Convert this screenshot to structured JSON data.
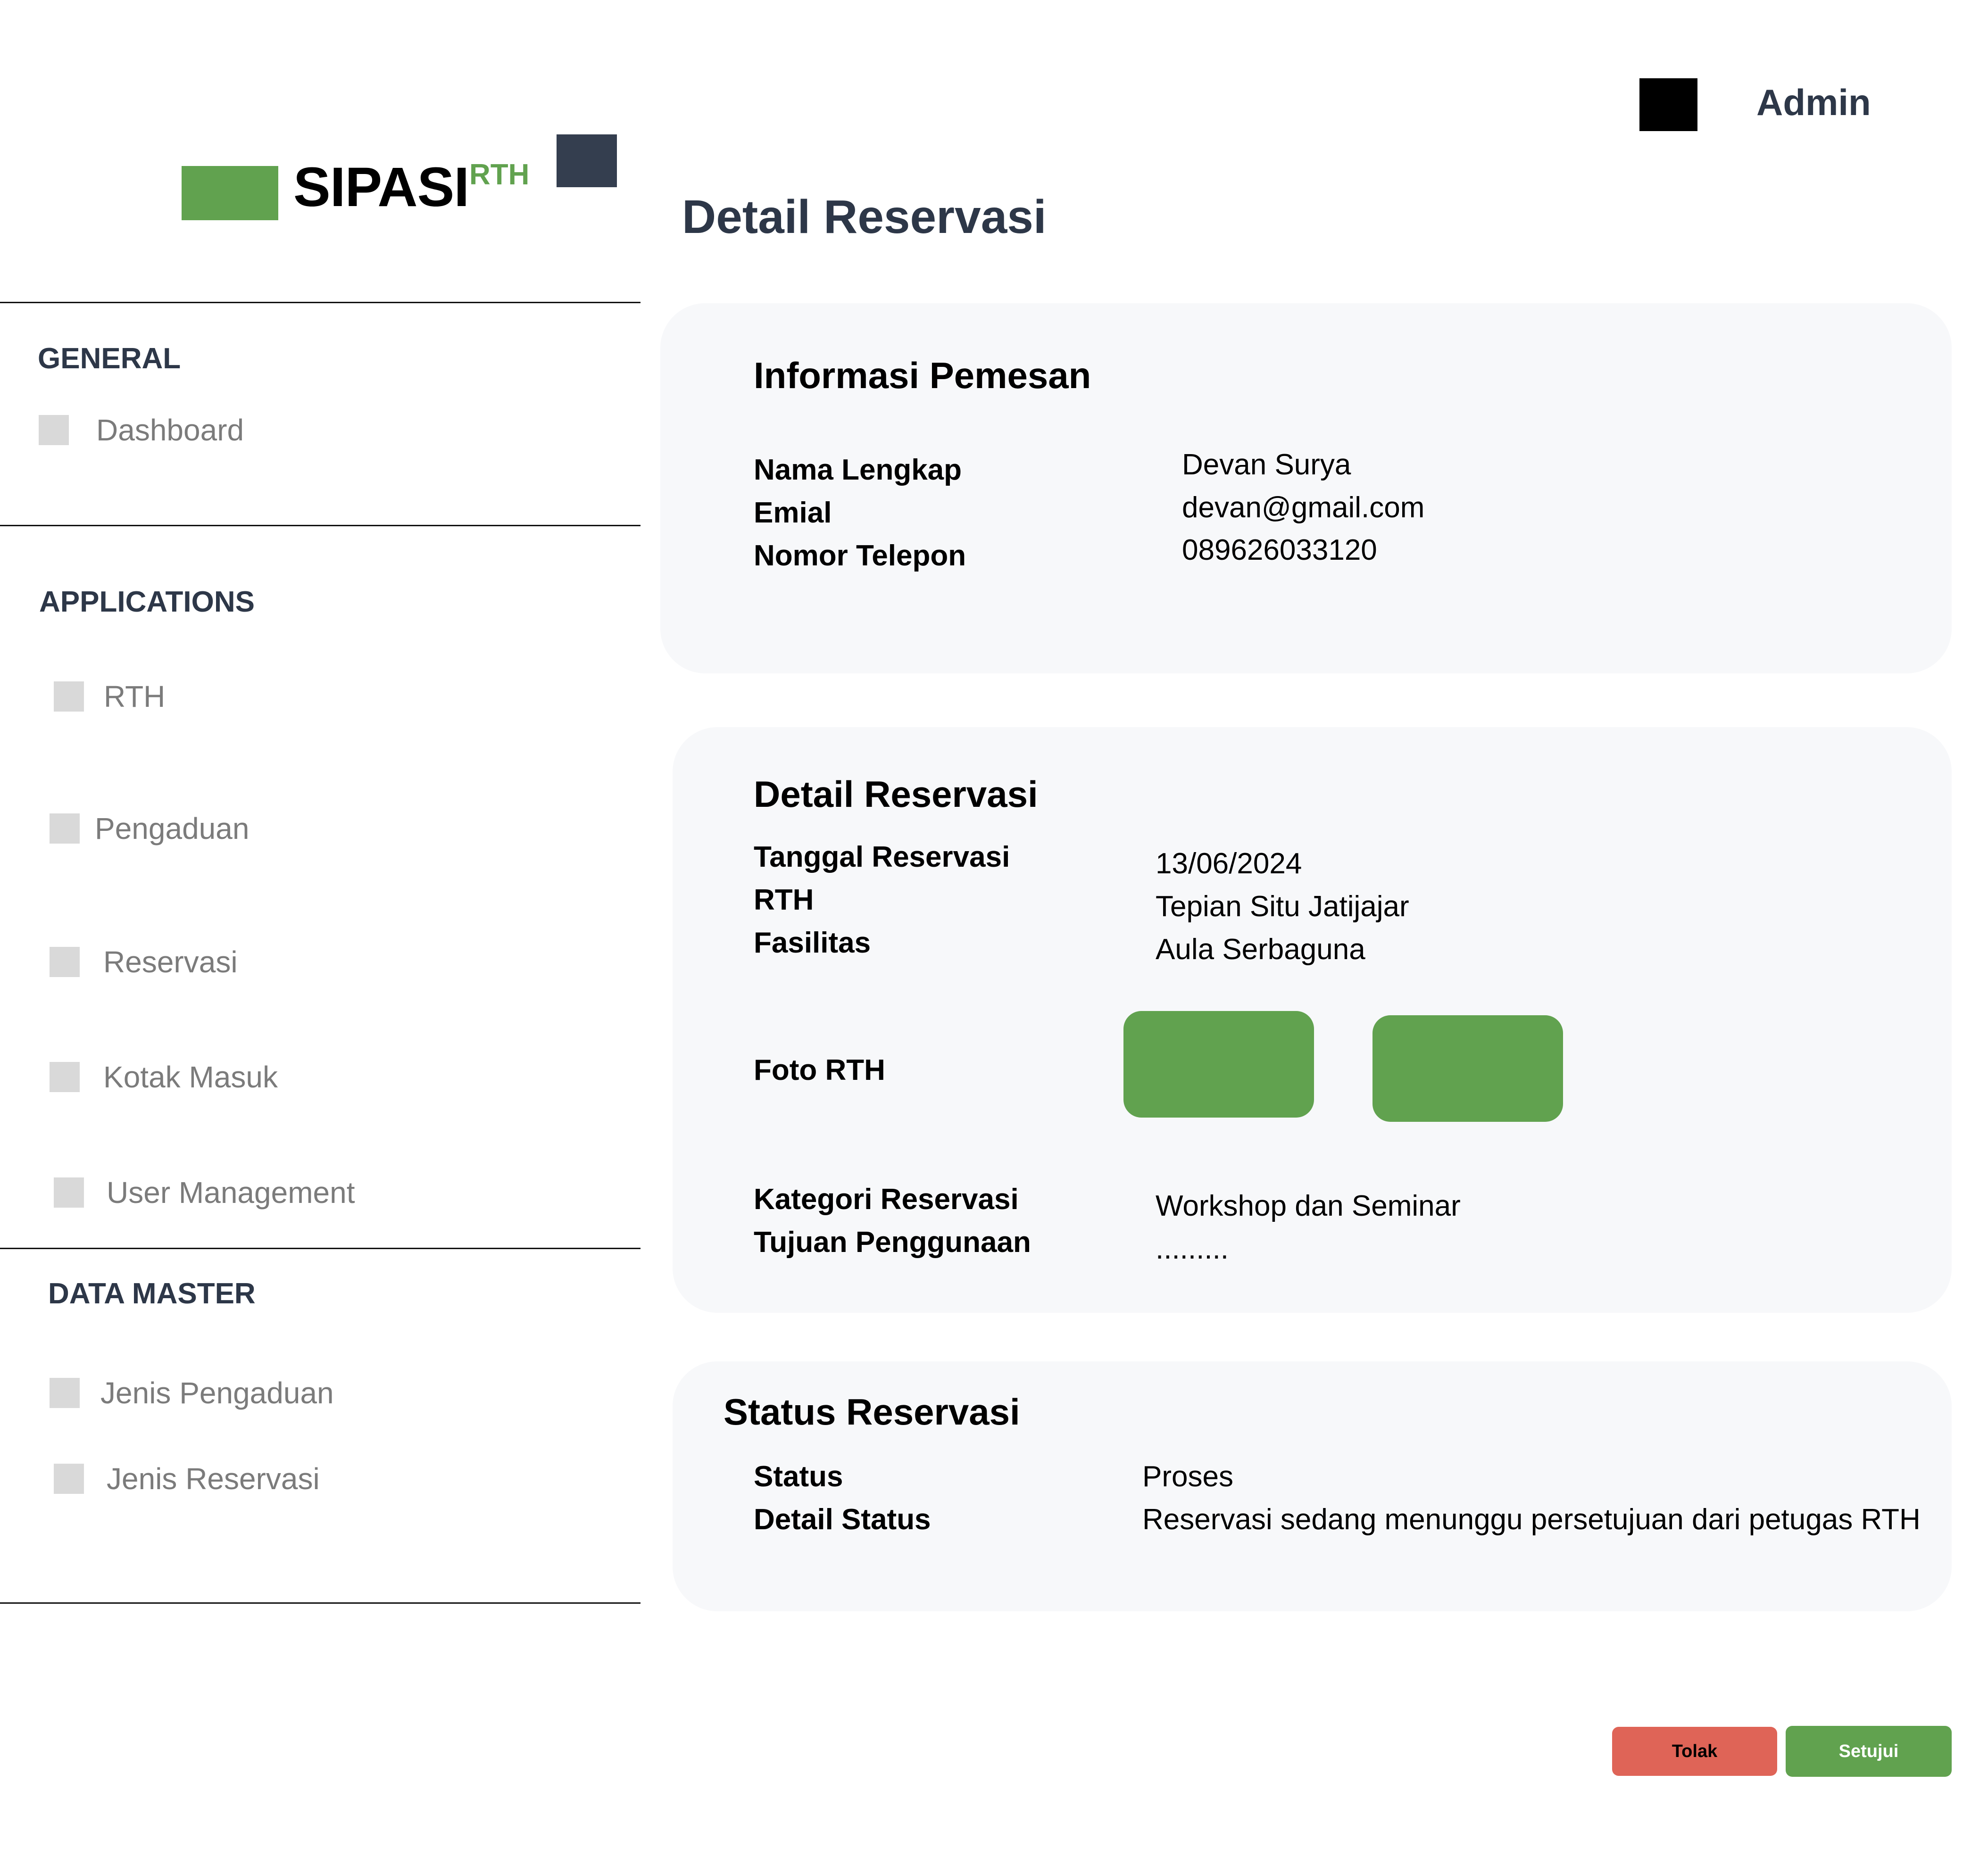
{
  "brand": {
    "name": "SIPASI",
    "suffix": "RTH",
    "color": "#61a24f"
  },
  "header": {
    "user_label": "Admin"
  },
  "page": {
    "title": "Detail Reservasi"
  },
  "sidebar": {
    "sections": [
      {
        "label": "GENERAL",
        "items": [
          {
            "label": "Dashboard"
          }
        ]
      },
      {
        "label": "APPLICATIONS",
        "items": [
          {
            "label": "RTH"
          },
          {
            "label": "Pengaduan"
          },
          {
            "label": "Reservasi"
          },
          {
            "label": "Kotak Masuk"
          },
          {
            "label": "User Management"
          }
        ]
      },
      {
        "label": "DATA MASTER",
        "items": [
          {
            "label": "Jenis Pengaduan"
          },
          {
            "label": "Jenis Reservasi"
          }
        ]
      }
    ]
  },
  "pemesan": {
    "title": "Informasi Pemesan",
    "fields": [
      {
        "label": "Nama Lengkap",
        "value": "Devan Surya"
      },
      {
        "label": "Emial",
        "value": "devan@gmail.com"
      },
      {
        "label": "Nomor Telepon",
        "value": "089626033120"
      }
    ]
  },
  "reservasi": {
    "title": "Detail Reservasi",
    "fields": [
      {
        "label": "Tanggal Reservasi",
        "value": "13/06/2024"
      },
      {
        "label": "RTH",
        "value": "Tepian Situ Jatijajar"
      },
      {
        "label": "Fasilitas",
        "value": "Aula Serbaguna"
      }
    ],
    "photo_label": "Foto RTH",
    "fields2": [
      {
        "label": "Kategori Reservasi",
        "value": "Workshop dan Seminar"
      },
      {
        "label": "Tujuan Penggunaan",
        "value": "........."
      }
    ]
  },
  "status": {
    "title": "Status Reservasi",
    "fields": [
      {
        "label": "Status",
        "value": "Proses"
      },
      {
        "label": "Detail Status",
        "value": "Reservasi sedang menunggu persetujuan dari petugas RTH"
      }
    ]
  },
  "actions": {
    "reject_label": "Tolak",
    "approve_label": "Setujui",
    "reject_color": "#df6457",
    "approve_color": "#61a24f"
  }
}
